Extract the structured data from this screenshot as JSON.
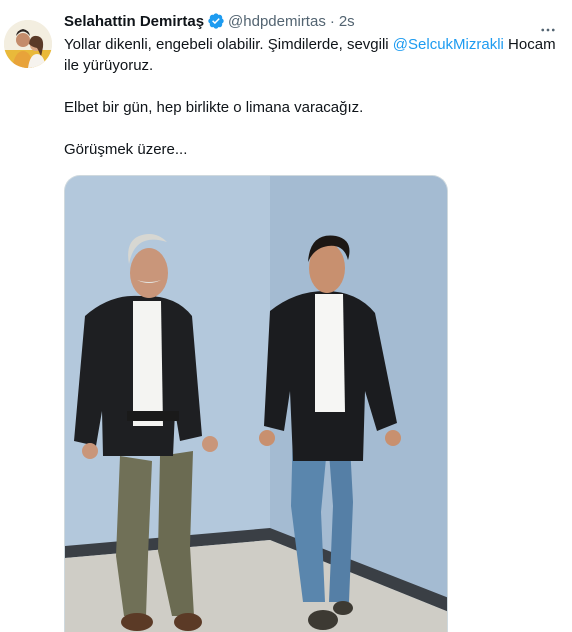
{
  "author": {
    "display_name": "Selahattin Demirtaş",
    "handle": "@hdpdemirtas",
    "separator": "·",
    "time": "2s",
    "verified": true
  },
  "tweet": {
    "line1_prefix": "Yollar dikenli, engebeli olabilir. Şimdilerde, sevgili ",
    "mention": "@SelcukMizrakli",
    "line1_suffix": " Hocam ile yürüyoruz.",
    "paragraph2": "Elbet bir gün, hep birlikte o limana varacağız.",
    "paragraph3": "Görüşmek üzere..."
  },
  "icons": {
    "verified": "verified-badge-icon",
    "more": "more-options-icon"
  },
  "colors": {
    "accent": "#1d9bf0",
    "secondary_text": "#536471",
    "primary_text": "#0f1419"
  }
}
